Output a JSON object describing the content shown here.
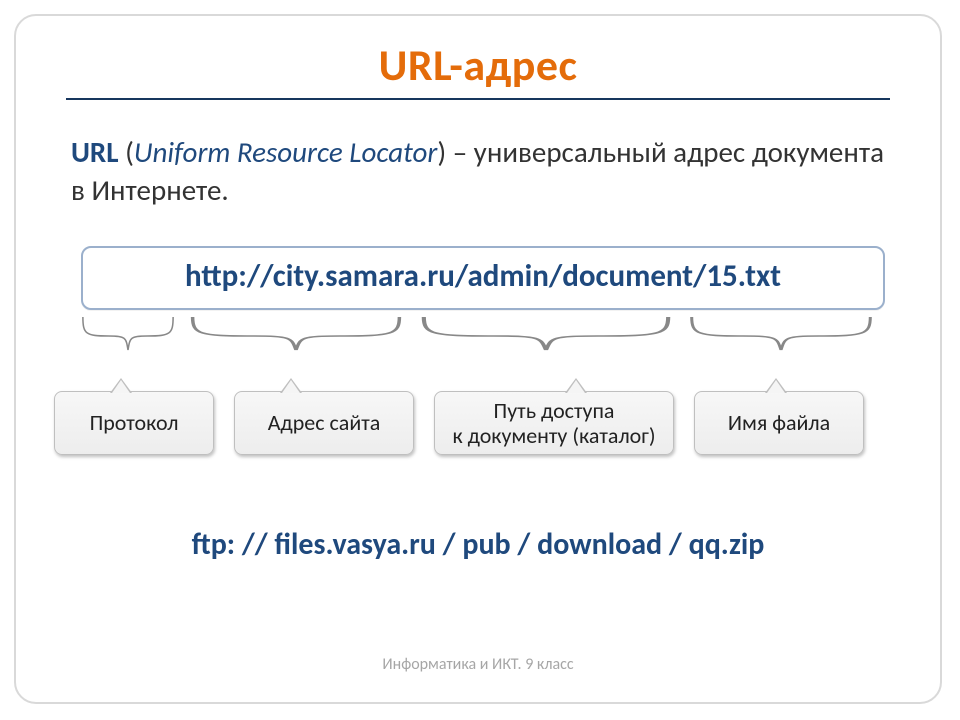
{
  "title": "URL-адрес",
  "intro": {
    "term": "URL",
    "paren_open": " (",
    "expansion": "Uniform Resource Locator",
    "paren_close": ") ",
    "rest": "– универсальный адрес документа в Интернете."
  },
  "url_example": "http://city.samara.ru/admin/document/15.txt",
  "parts": {
    "protocol": "Протокол",
    "site": "Адрес сайта",
    "path": "Путь доступа\nк документу (каталог)",
    "file": "Имя файла"
  },
  "example2": "ftp: // files.vasya.ru / pub / download / qq.zip",
  "footer": "Информатика и ИКТ. 9 класс"
}
